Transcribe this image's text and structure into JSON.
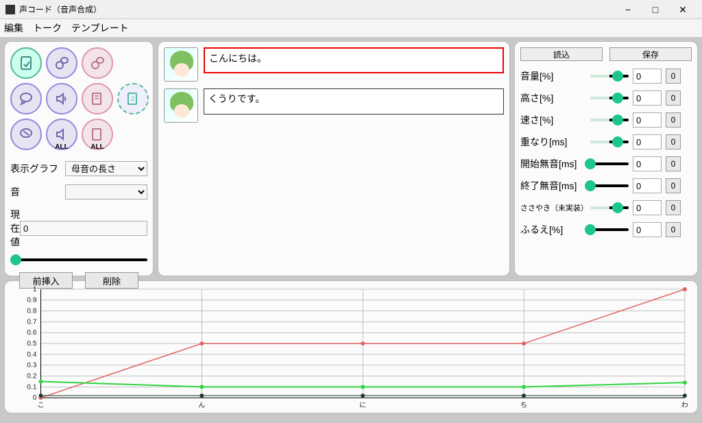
{
  "window": {
    "title": "声コード（音声合成）"
  },
  "menu": {
    "edit": "編集",
    "talk": "トーク",
    "template": "テンプレート"
  },
  "toolbar": {
    "all_label": "ALL"
  },
  "left": {
    "graph_label": "表示グラフ",
    "graph_option": "母音の長さ",
    "sound_label": "音",
    "sound_option": "",
    "current_label": "現在値",
    "current_value": "0",
    "insert_before": "前挿入",
    "delete": "削除"
  },
  "talks": [
    {
      "text": "こんにちは。",
      "selected": true
    },
    {
      "text": "くうりです。",
      "selected": false
    }
  ],
  "right": {
    "load": "読込",
    "save": "保存",
    "params": [
      {
        "label": "音量[%]",
        "slider": "mid",
        "thumb": 40,
        "value": "0",
        "small": false
      },
      {
        "label": "高さ[%]",
        "slider": "mid",
        "thumb": 40,
        "value": "0",
        "small": false
      },
      {
        "label": "速さ[%]",
        "slider": "mid",
        "thumb": 40,
        "value": "0",
        "small": false
      },
      {
        "label": "重なり[ms]",
        "slider": "mid",
        "thumb": 40,
        "value": "0",
        "small": false
      },
      {
        "label": "開始無音[ms]",
        "slider": "left",
        "thumb": 0,
        "value": "0",
        "small": false
      },
      {
        "label": "終了無音[ms]",
        "slider": "left",
        "thumb": 0,
        "value": "0",
        "small": false
      },
      {
        "label": "ささやき（未実装）[-]",
        "slider": "mid",
        "thumb": 40,
        "value": "0",
        "small": true
      },
      {
        "label": "ふるえ[%]",
        "slider": "left",
        "thumb": 0,
        "value": "0",
        "small": false
      }
    ],
    "zero_btn": "0"
  },
  "chart_data": {
    "type": "line",
    "categories": [
      "こ",
      "ん",
      "に",
      "ち",
      "わ"
    ],
    "ylim": [
      0,
      1
    ],
    "yticks": [
      0,
      0.1,
      0.2,
      0.3,
      0.4,
      0.5,
      0.6,
      0.7,
      0.8,
      0.9,
      1
    ],
    "series": [
      {
        "name": "red",
        "values": [
          0.0,
          0.5,
          0.5,
          0.5,
          1.0
        ]
      },
      {
        "name": "green",
        "values": [
          0.15,
          0.1,
          0.1,
          0.1,
          0.14
        ]
      },
      {
        "name": "dark",
        "values": [
          0.02,
          0.02,
          0.02,
          0.02,
          0.02
        ]
      }
    ]
  }
}
